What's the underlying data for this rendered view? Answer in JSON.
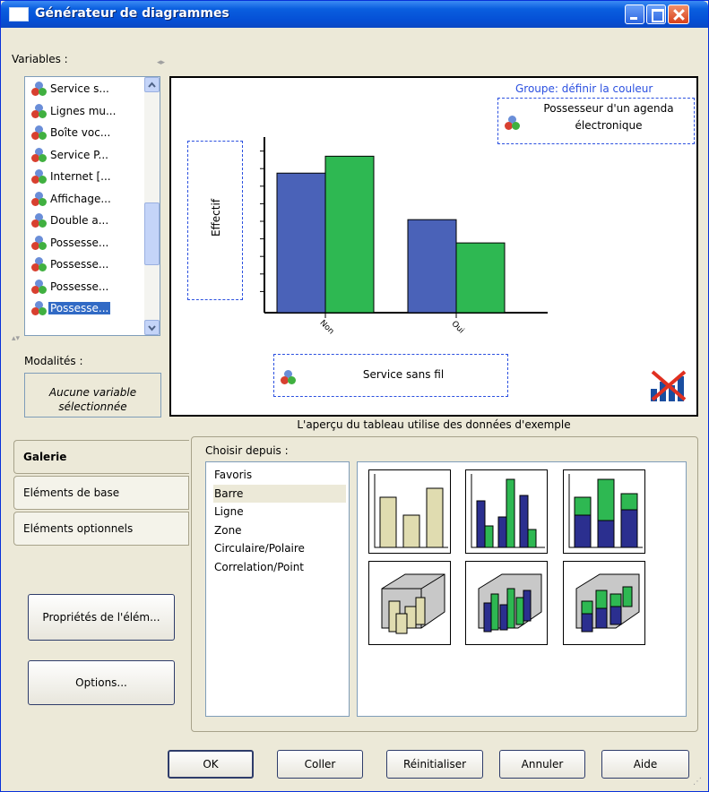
{
  "window": {
    "title": "Générateur de diagrammes"
  },
  "variables": {
    "label": "Variables :",
    "items": [
      {
        "text": "Service s..."
      },
      {
        "text": "Lignes mu..."
      },
      {
        "text": "Boîte voc..."
      },
      {
        "text": "Service P..."
      },
      {
        "text": "Internet [..."
      },
      {
        "text": "Affichage..."
      },
      {
        "text": "Double a..."
      },
      {
        "text": "Possesse..."
      },
      {
        "text": "Possesse..."
      },
      {
        "text": "Possesse..."
      },
      {
        "text": "Possesse...",
        "selected": true
      }
    ]
  },
  "modalites": {
    "label": "Modalités :",
    "empty_line1": "Aucune variable",
    "empty_line2": "sélectionnée"
  },
  "preview": {
    "group_title": "Groupe: définir la couleur",
    "group_var_line1": "Possesseur d'un agenda",
    "group_var_line2": "électronique",
    "y_axis_label": "Effectif",
    "x_axis_var": "Service sans fil",
    "caption": "L'aperçu du tableau utilise des données d'exemple"
  },
  "chart_data": {
    "type": "bar",
    "categories": [
      "Non",
      "Oui"
    ],
    "series": [
      {
        "values": [
          6.6,
          4.4
        ],
        "color": "#4a62b8"
      },
      {
        "values": [
          7.4,
          3.3
        ],
        "color": "#2eb852"
      }
    ],
    "ylim": [
      0,
      10
    ],
    "ylabel": "Effectif",
    "xlabel": "Service sans fil"
  },
  "tabs": [
    {
      "label": "Galerie",
      "active": true
    },
    {
      "label": "Eléments de base"
    },
    {
      "label": "Eléments optionnels"
    }
  ],
  "side_buttons": {
    "properties": "Propriétés de l'élém...",
    "options": "Options..."
  },
  "gallery": {
    "choose_label": "Choisir depuis :",
    "categories": [
      "Favoris",
      "Barre",
      "Ligne",
      "Zone",
      "Circulaire/Polaire",
      "Correlation/Point"
    ],
    "selected_category": "Barre",
    "thumbnails": [
      "simple-bar",
      "clustered-bar",
      "stacked-bar",
      "3d-simple-bar",
      "3d-clustered-bar",
      "3d-stacked-bar"
    ]
  },
  "footer": {
    "ok": "OK",
    "paste": "Coller",
    "reset": "Réinitialiser",
    "cancel": "Annuler",
    "help": "Aide"
  },
  "colors": {
    "accent": "#316ac5",
    "title_bar": "#0a5fdf",
    "bar_blue": "#4a62b8",
    "bar_green": "#2eb852",
    "thumb_beige": "#e0dcb0",
    "thumb_navy": "#2b2f8f"
  }
}
